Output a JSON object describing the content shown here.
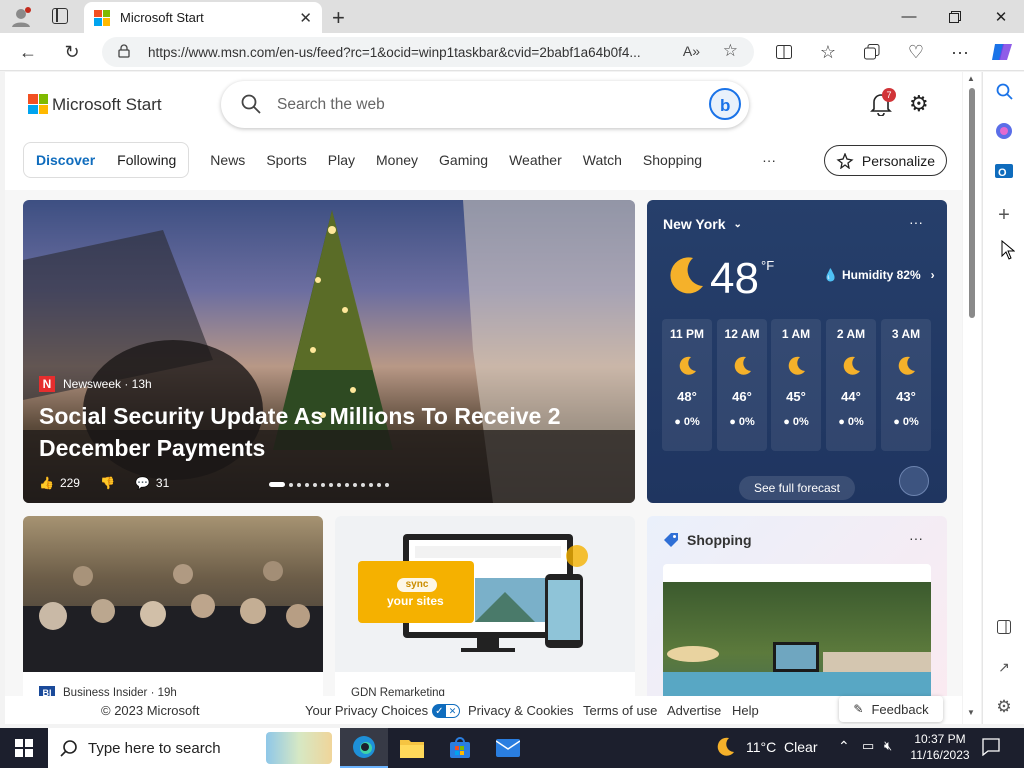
{
  "browser": {
    "tab_title": "Microsoft Start",
    "url": "https://www.msn.com/en-us/feed?rc=1&ocid=winp1taskbar&cvid=2babf1a64b0f4..."
  },
  "header": {
    "brand": "Microsoft Start",
    "search_placeholder": "Search the web",
    "notification_count": "7",
    "tabs": [
      {
        "label": "Discover",
        "active": true
      },
      {
        "label": "Following"
      }
    ],
    "nav": [
      "News",
      "Sports",
      "Play",
      "Money",
      "Gaming",
      "Weather",
      "Watch",
      "Shopping"
    ],
    "more": "···",
    "personalize": "Personalize"
  },
  "hero": {
    "source": "Newsweek · 13h",
    "headline": "Social Security Update As Millions To Receive 2 December Payments",
    "likes": "229",
    "comments": "31"
  },
  "weather": {
    "location": "New York",
    "temp": "48",
    "unit": "°F",
    "humidity": "Humidity 82%",
    "hours": [
      {
        "time": "11 PM",
        "temp": "48°",
        "precip": "0%"
      },
      {
        "time": "12 AM",
        "temp": "46°",
        "precip": "0%"
      },
      {
        "time": "1 AM",
        "temp": "45°",
        "precip": "0%"
      },
      {
        "time": "2 AM",
        "temp": "44°",
        "precip": "0%"
      },
      {
        "time": "3 AM",
        "temp": "43°",
        "precip": "0%"
      }
    ],
    "forecast_link": "See full forecast",
    "more": "···"
  },
  "cards": {
    "card1_source": "Business Insider · 19h",
    "card2_source": "GDN Remarketing",
    "card2_sync": "sync",
    "card2_your_sites": "your sites",
    "shopping_title": "Shopping",
    "shopping_more": "···"
  },
  "footer": {
    "copyright": "© 2023 Microsoft",
    "privacy_choices": "Your Privacy Choices",
    "privacy": "Privacy & Cookies",
    "terms": "Terms of use",
    "advertise": "Advertise",
    "help": "Help",
    "feedback": "Feedback"
  },
  "taskbar": {
    "search_placeholder": "Type here to search",
    "weather": "11°C  Clear",
    "time": "10:37 PM",
    "date": "11/16/2023"
  },
  "colors": {
    "accent": "#0f6cbd",
    "weather_bg": "#263f6b",
    "taskbar_bg": "#1c1f2d",
    "notification_badge": "#d13438"
  }
}
